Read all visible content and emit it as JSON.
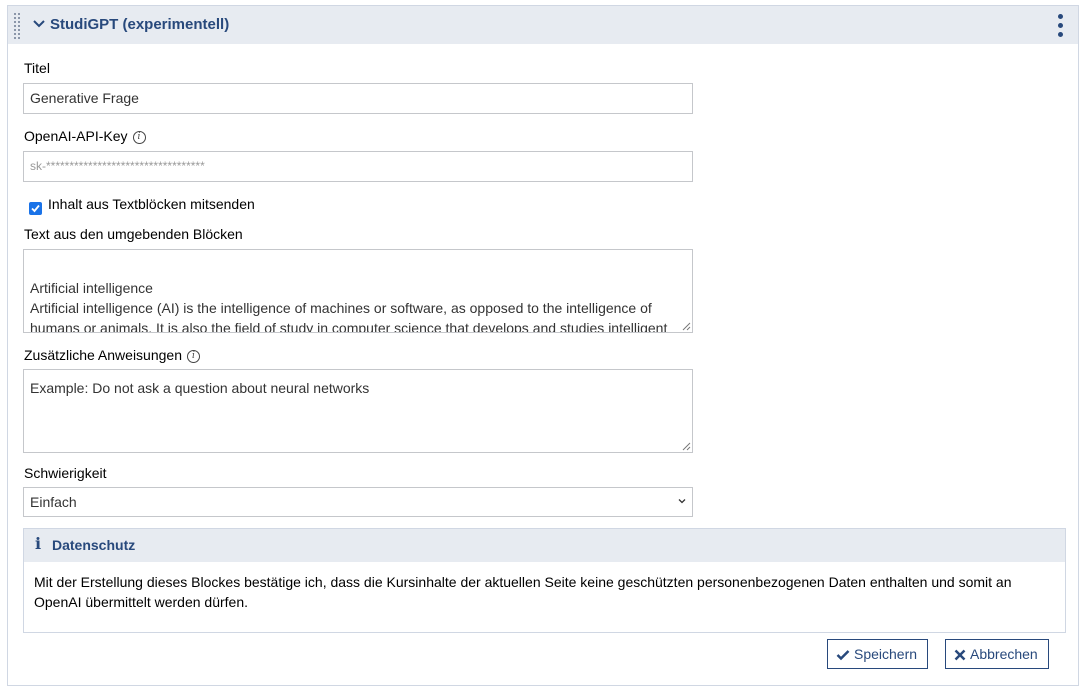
{
  "header": {
    "title": "StudiGPT (experimentell)"
  },
  "form": {
    "title_label": "Titel",
    "title_value": "Generative Frage",
    "apikey_label": "OpenAI-API-Key",
    "apikey_value": "sk-**********************************",
    "checkbox_label": "Inhalt aus Textblöcken mitsenden",
    "context_label": "Text aus den umgebenden Blöcken",
    "context_value": "Artificial intelligence\nArtificial intelligence (AI) is the intelligence of machines or software, as opposed to the intelligence of humans or animals. It is also the field of study in computer science that develops and studies intelligent machines. \"AI\" may also refer to the machines themselves.",
    "instructions_label": "Zusätzliche Anweisungen",
    "instructions_placeholder": "Example: Do not ask a question about neural networks",
    "difficulty_label": "Schwierigkeit",
    "difficulty_value": "Einfach"
  },
  "notice": {
    "title": "Datenschutz",
    "text": "Mit der Erstellung dieses Blockes bestätige ich, dass die Kursinhalte der aktuellen Seite keine geschützten personenbezogenen Daten enthalten und somit an OpenAI übermittelt werden dürfen."
  },
  "buttons": {
    "save": "Speichern",
    "cancel": "Abbrechen"
  },
  "colors": {
    "accent": "#28497c",
    "header_bg": "#e7ebf1",
    "checkbox": "#1a73e8"
  }
}
